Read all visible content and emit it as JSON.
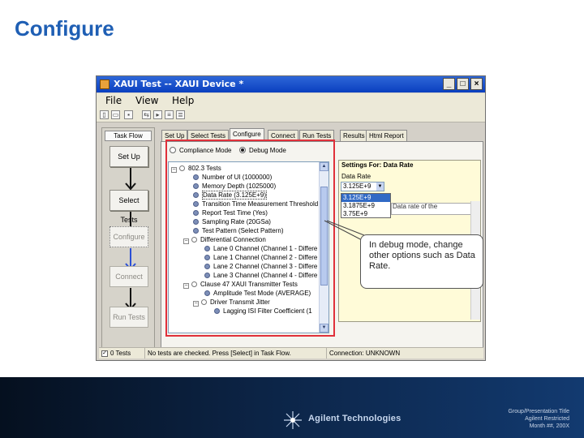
{
  "slide": {
    "title": "Configure",
    "callout_text": "In debug mode, change other options such as Data Rate."
  },
  "window": {
    "title": "XAUI Test -- XAUI Device *",
    "menu": [
      "File",
      "View",
      "Help"
    ]
  },
  "task_flow": {
    "header": "Task Flow",
    "steps": [
      {
        "label": "Set Up",
        "enabled": true
      },
      {
        "label": "Select Tests",
        "enabled": true
      },
      {
        "label": "Configure",
        "enabled": false
      },
      {
        "label": "Connect",
        "enabled": false
      },
      {
        "label": "Run Tests",
        "enabled": false
      }
    ]
  },
  "tabs": [
    "Set Up",
    "Select Tests",
    "Configure",
    "Connect",
    "Run Tests",
    "Results",
    "Html Report"
  ],
  "active_tab": "Configure",
  "mode": {
    "compliance_label": "Compliance Mode",
    "debug_label": "Debug Mode",
    "selected": "Debug Mode"
  },
  "tree": {
    "items": [
      "802.3 Tests",
      "Number of UI (1000000)",
      "Memory Depth (1025000)",
      "Data Rate (3.125E+9)",
      "Transition Time Measurement Threshold",
      "Report Test Time (Yes)",
      "Sampling Rate (20GSa)",
      "Test Pattern (Select Pattern)",
      "Differential Connection",
      "Lane 0 Channel (Channel 1 - Differe",
      "Lane 1 Channel (Channel 2 - Differe",
      "Lane 2 Channel (Channel 3 - Differe",
      "Lane 3 Channel (Channel 4 - Differe",
      "Clause 47 XAUI Transmitter Tests",
      "Amplitude Test Mode (AVERAGE)",
      "Driver Transmit Jitter",
      "Lagging ISI Filter Coefficient (1"
    ]
  },
  "settings": {
    "title": "Settings For: Data Rate",
    "field_label": "Data Rate",
    "value": "3.125E+9",
    "options": [
      "3.125E+9",
      "3.1875E+9",
      "3.75E+9"
    ],
    "selected_option": "3.125E+9",
    "description": "Data rate of the"
  },
  "status_bar": {
    "tests_label": "0 Tests",
    "message": "No tests are checked. Press [Select] in Task Flow.",
    "connection": "Connection: UNKNOWN"
  },
  "footer": {
    "brand": "Agilent Technologies",
    "line1": "Group/Presentation Title",
    "line2": "Agilent Restricted",
    "line3": "Month ##, 200X"
  },
  "colors": {
    "title_blue": "#1f5fb4",
    "highlight_red": "#e0303a",
    "selection_blue": "#316ac5"
  }
}
